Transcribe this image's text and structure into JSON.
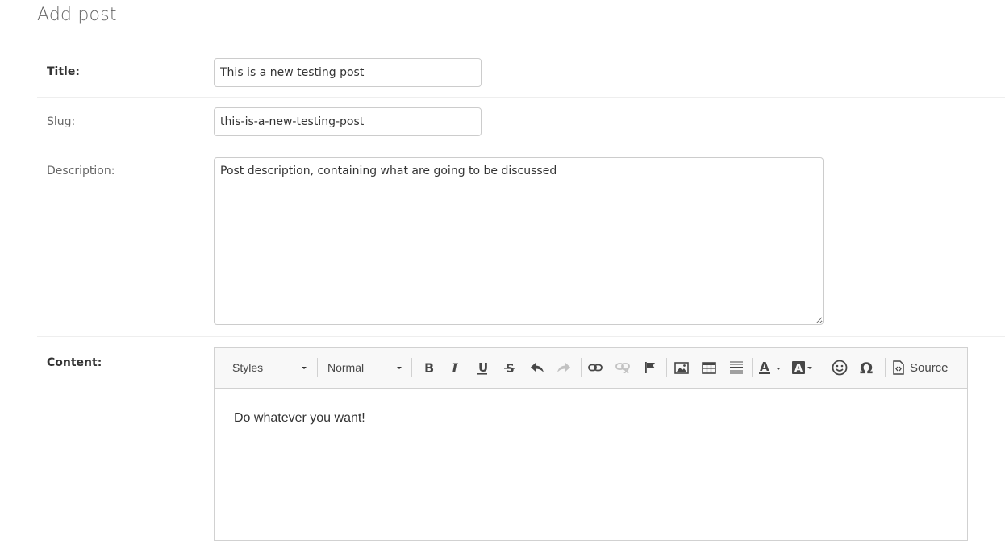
{
  "page": {
    "title": "Add post"
  },
  "form": {
    "title": {
      "label": "Title:",
      "value": "This is a new testing post"
    },
    "slug": {
      "label": "Slug:",
      "value": "this-is-a-new-testing-post"
    },
    "description": {
      "label": "Description:",
      "value": "Post description, containing what are going to be discussed"
    },
    "content": {
      "label": "Content:",
      "body": "Do whatever you want!",
      "toolbar": {
        "styles_label": "Styles",
        "format_label": "Normal",
        "source_label": "Source",
        "buttons": [
          "bold",
          "italic",
          "underline",
          "strike",
          "undo",
          "redo",
          "link",
          "unlink",
          "anchor",
          "image",
          "table",
          "horizontal-rule",
          "text-color",
          "background-color",
          "smiley",
          "special-char",
          "source"
        ]
      }
    }
  },
  "colors": {
    "border": "#cccccc",
    "label": "#666666",
    "text": "#333333",
    "toolbar_bg": "#f8f8f8"
  }
}
